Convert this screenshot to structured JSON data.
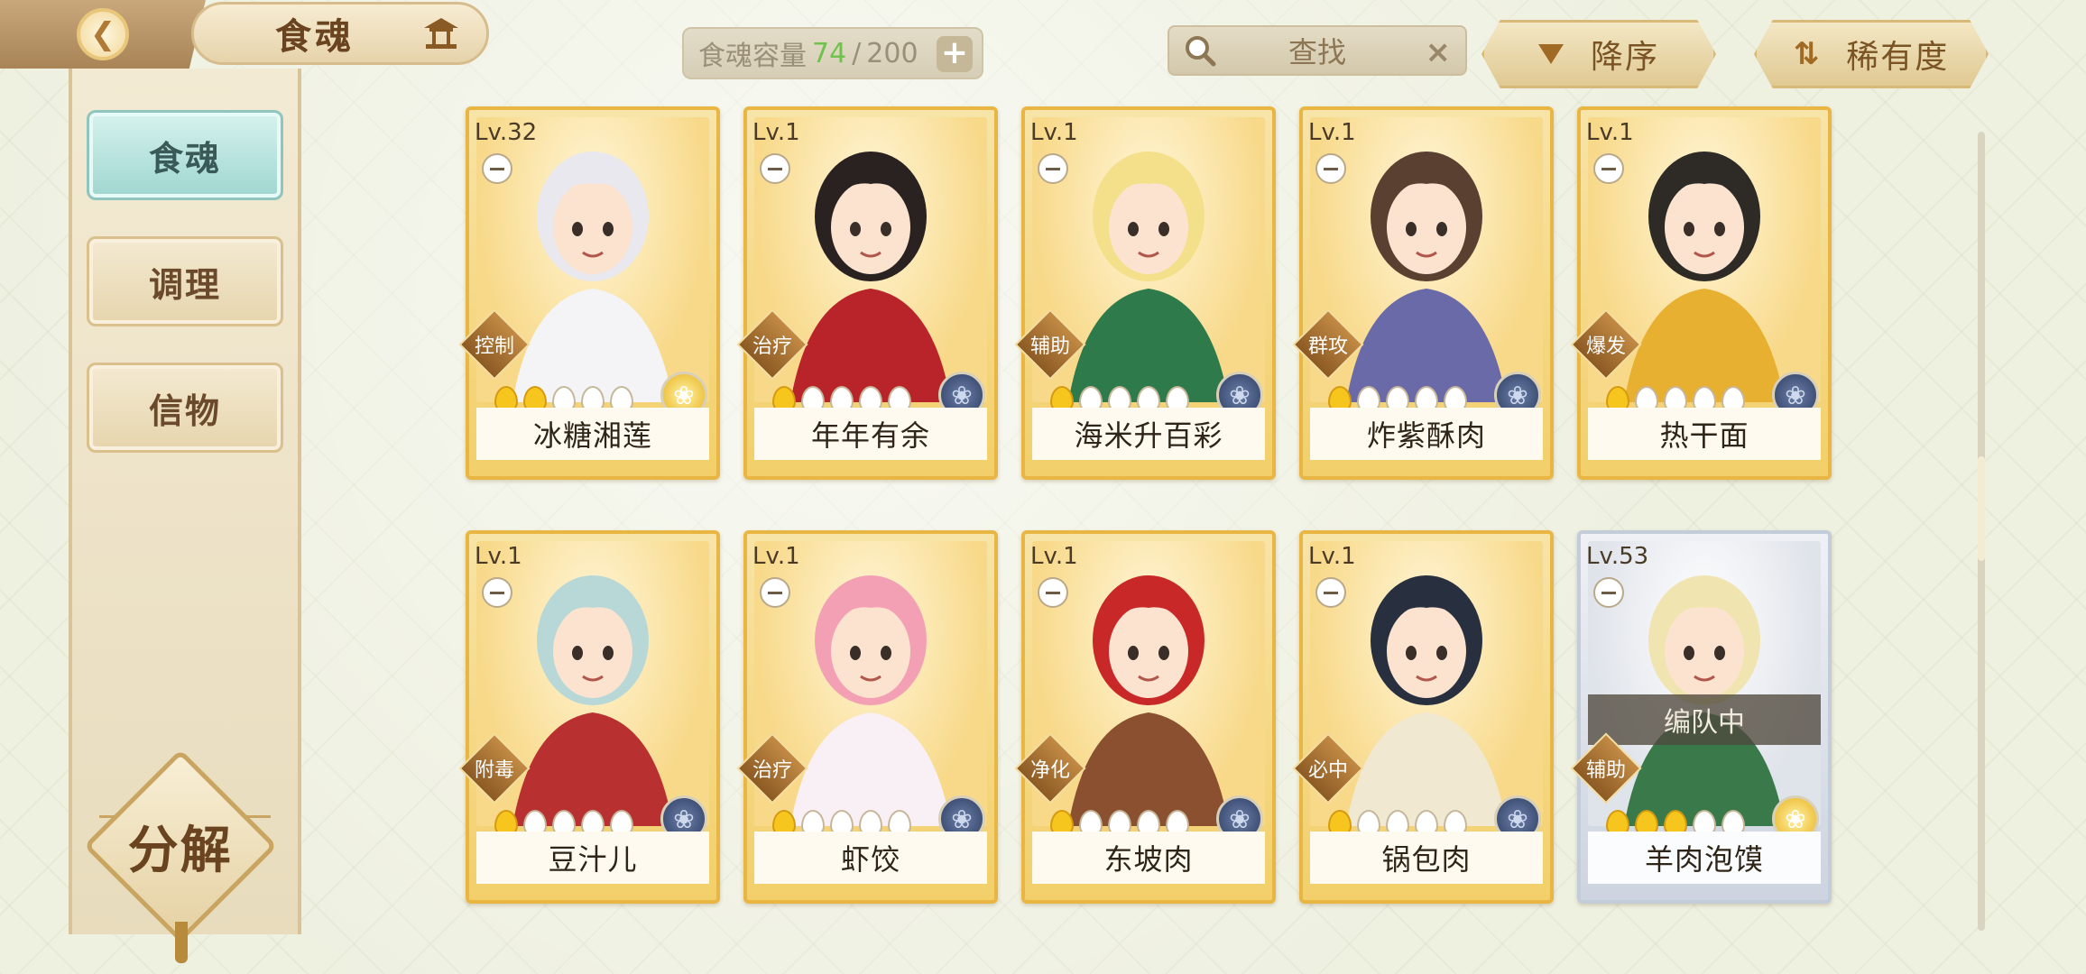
{
  "header": {
    "back_icon": "back-arrow-icon",
    "title": "食魂",
    "capacity": {
      "label": "食魂容量",
      "current": "74",
      "separator": "/",
      "max": "200",
      "add_icon": "+"
    },
    "search": {
      "icon": "search-icon",
      "label": "查找",
      "clear_icon": "×"
    },
    "sort_order": {
      "label": "降序"
    },
    "sort_key": {
      "label": "稀有度"
    }
  },
  "sidebar": {
    "tabs": [
      {
        "label": "食魂",
        "active": true
      },
      {
        "label": "调理",
        "active": false
      },
      {
        "label": "信物",
        "active": false
      }
    ],
    "decompose_label": "分解"
  },
  "cards": [
    {
      "level": "Lv.32",
      "role": "控制",
      "name": "冰糖湘莲",
      "stars": 2,
      "gem": "gold-flame",
      "frame": "gold",
      "hair": "#e8e8ee",
      "outfit": "#f4f4f6",
      "team": ""
    },
    {
      "level": "Lv.1",
      "role": "治疗",
      "name": "年年有余",
      "stars": 1,
      "gem": "blue-flower",
      "frame": "gold",
      "hair": "#2a2220",
      "outfit": "#b8242a",
      "team": ""
    },
    {
      "level": "Lv.1",
      "role": "辅助",
      "name": "海米升百彩",
      "stars": 1,
      "gem": "blue-flower",
      "frame": "gold",
      "hair": "#f4e08a",
      "outfit": "#2e7a4a",
      "team": ""
    },
    {
      "level": "Lv.1",
      "role": "群攻",
      "name": "炸紫酥肉",
      "stars": 1,
      "gem": "blue-flower",
      "frame": "gold",
      "hair": "#5a4030",
      "outfit": "#6a6aa8",
      "team": ""
    },
    {
      "level": "Lv.1",
      "role": "爆发",
      "name": "热干面",
      "stars": 1,
      "gem": "blue-flower",
      "frame": "gold",
      "hair": "#2e2a26",
      "outfit": "#e8b030",
      "team": ""
    },
    {
      "level": "Lv.1",
      "role": "附毒",
      "name": "豆汁儿",
      "stars": 1,
      "gem": "blue-flower",
      "frame": "gold",
      "hair": "#b8d8d8",
      "outfit": "#b83030",
      "team": ""
    },
    {
      "level": "Lv.1",
      "role": "治疗",
      "name": "虾饺",
      "stars": 1,
      "gem": "blue-flower",
      "frame": "gold",
      "hair": "#f4a0b4",
      "outfit": "#f8f0f4",
      "team": ""
    },
    {
      "level": "Lv.1",
      "role": "净化",
      "name": "东坡肉",
      "stars": 1,
      "gem": "blue-flower",
      "frame": "gold",
      "hair": "#c82828",
      "outfit": "#8a5030",
      "team": ""
    },
    {
      "level": "Lv.1",
      "role": "必中",
      "name": "锅包肉",
      "stars": 1,
      "gem": "blue-flower",
      "frame": "gold",
      "hair": "#283040",
      "outfit": "#f0e8d0",
      "team": ""
    },
    {
      "level": "Lv.53",
      "role": "辅助",
      "name": "羊肉泡馍",
      "stars": 3,
      "gem": "gold-flower",
      "frame": "silver",
      "hair": "#f0e4b0",
      "outfit": "#3a7a4a",
      "team": "编队中"
    }
  ]
}
